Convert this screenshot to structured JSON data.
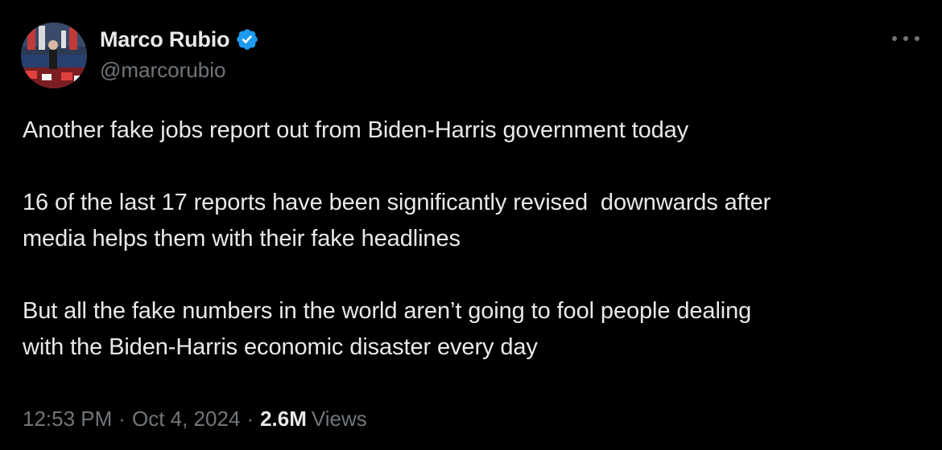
{
  "author": {
    "display_name": "Marco Rubio",
    "handle": "@marcorubio",
    "verified_icon": "verified-badge-icon",
    "avatar_icon": "profile-photo"
  },
  "menu": {
    "more_icon": "more-options-icon"
  },
  "tweet": {
    "paragraphs": [
      "Another fake jobs report out from Biden-Harris government today",
      "16 of the last 17 reports have been significantly revised  downwards after\nmedia helps them with their fake headlines",
      "But all the fake numbers in the world aren’t going to fool people dealing\nwith the Biden-Harris economic disaster every day"
    ]
  },
  "meta": {
    "time": "12:53 PM",
    "separator": "·",
    "date": "Oct 4, 2024",
    "views_count": "2.6M",
    "views_label": "Views"
  },
  "colors": {
    "background": "#000000",
    "text_primary": "#e7e9ea",
    "text_secondary": "#71767b",
    "verified_blue": "#1d9bf0"
  }
}
